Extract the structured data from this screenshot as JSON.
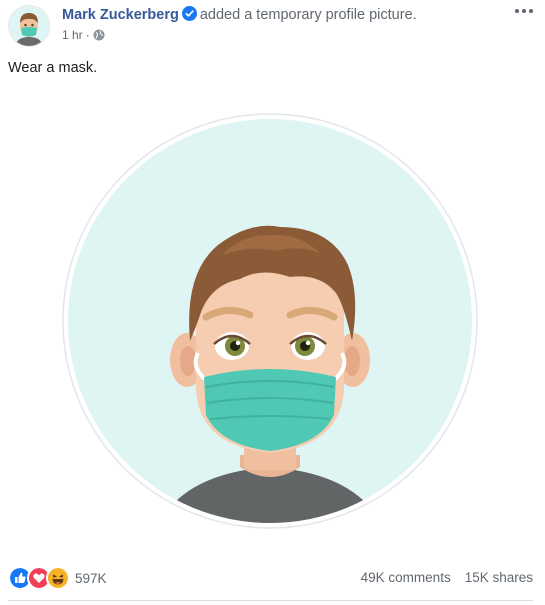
{
  "post": {
    "author": "Mark Zuckerberg",
    "action": "added a temporary profile picture.",
    "time": "1 hr",
    "separator": "·",
    "caption": "Wear a mask.",
    "icons": {
      "verified": "verified-badge-icon",
      "audience": "globe-icon",
      "more": "more-options-icon"
    }
  },
  "reactions": {
    "icons": [
      "like-icon",
      "love-icon",
      "haha-icon"
    ],
    "count": "597K"
  },
  "stats": {
    "comments": "49K comments",
    "shares": "15K shares"
  },
  "colors": {
    "author": "#385898",
    "secondary_text": "#606770",
    "photo_background": "#dff5f3",
    "mask": "#4fc9b4",
    "like": "#1877f2",
    "love": "#f33e58",
    "haha": "#f7b125"
  }
}
